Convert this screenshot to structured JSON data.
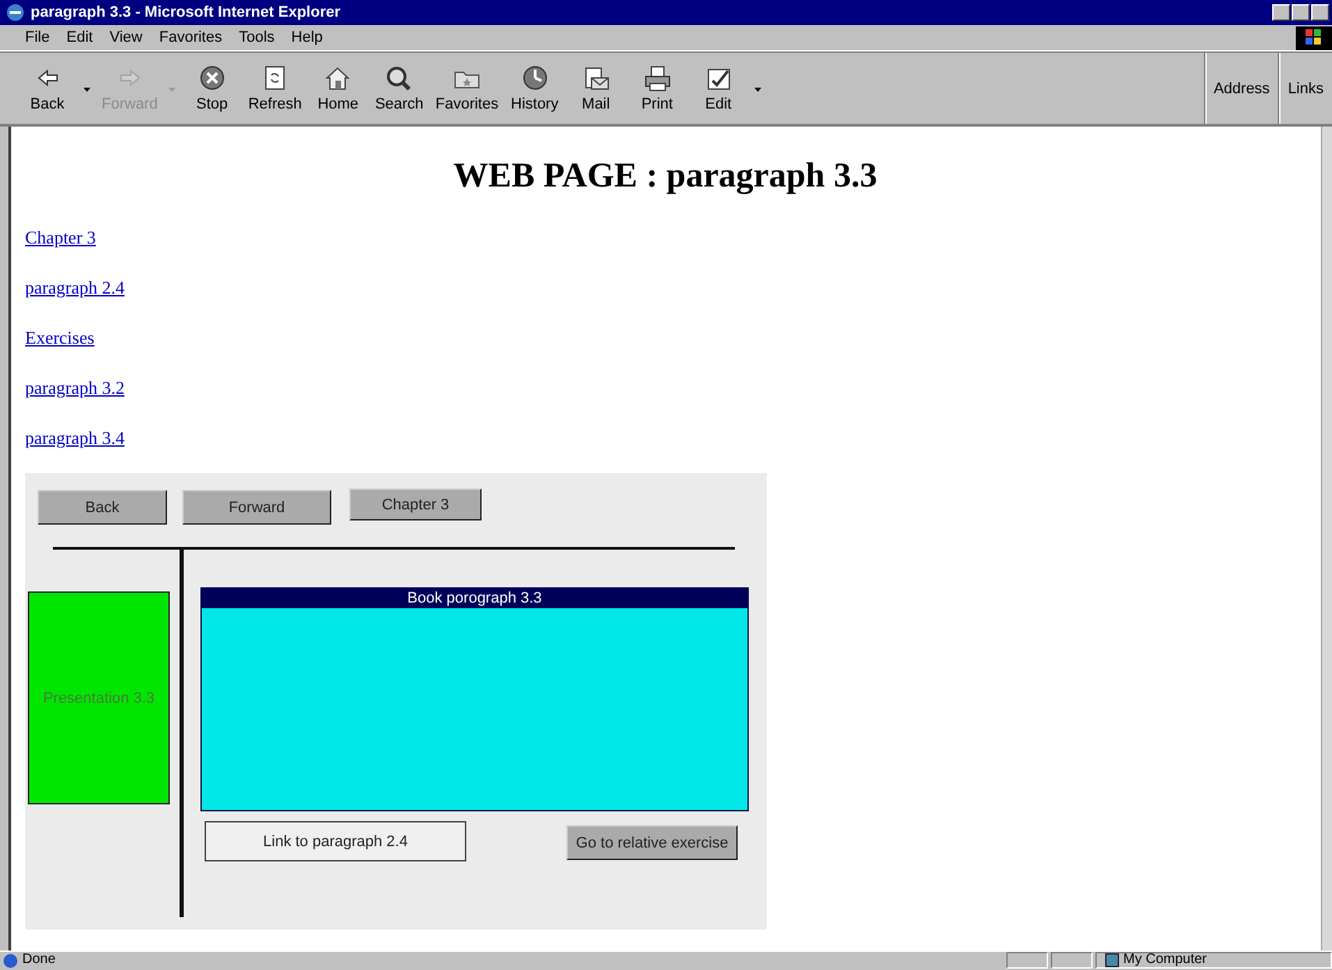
{
  "window": {
    "title": "paragraph 3.3 - Microsoft Internet Explorer"
  },
  "menu": [
    {
      "label": "File"
    },
    {
      "label": "Edit"
    },
    {
      "label": "View"
    },
    {
      "label": "Favorites"
    },
    {
      "label": "Tools"
    },
    {
      "label": "Help"
    }
  ],
  "toolbar": [
    {
      "kind": "back",
      "label": "Back",
      "disabled": false,
      "dropdown": true
    },
    {
      "kind": "forward",
      "label": "Forward",
      "disabled": true,
      "dropdown": true
    },
    {
      "kind": "stop",
      "label": "Stop",
      "disabled": false,
      "dropdown": false
    },
    {
      "kind": "refresh",
      "label": "Refresh",
      "disabled": false,
      "dropdown": false
    },
    {
      "kind": "home",
      "label": "Home",
      "disabled": false,
      "dropdown": false
    },
    {
      "kind": "search",
      "label": "Search",
      "disabled": false,
      "dropdown": false
    },
    {
      "kind": "favorites",
      "label": "Favorites",
      "disabled": false,
      "dropdown": false
    },
    {
      "kind": "history",
      "label": "History",
      "disabled": false,
      "dropdown": false
    },
    {
      "kind": "mail",
      "label": "Mail",
      "disabled": false,
      "dropdown": false
    },
    {
      "kind": "print",
      "label": "Print",
      "disabled": false,
      "dropdown": false
    },
    {
      "kind": "edit",
      "label": "Edit",
      "disabled": false,
      "dropdown": true
    }
  ],
  "toolbar_bands": [
    {
      "label": "Address"
    },
    {
      "label": "Links"
    }
  ],
  "page": {
    "heading": "WEB PAGE : paragraph 3.3",
    "links": [
      {
        "label": "Chapter 3"
      },
      {
        "label": "paragraph 2.4"
      },
      {
        "label": "Exercises"
      },
      {
        "label": "paragraph 3.2"
      },
      {
        "label": "paragraph 3.4"
      }
    ],
    "applet": {
      "nav_buttons": [
        {
          "label": "Back"
        },
        {
          "label": "Forward"
        },
        {
          "label": "Chapter 3"
        }
      ],
      "side_panel": "Presentation 3.3",
      "content_title": "Book porograph 3.3",
      "link_box": "Link to paragraph 2.4",
      "exercise_button": "Go to relative exercise"
    }
  },
  "status_bar": {
    "text": "Done",
    "zone": "My Computer"
  }
}
